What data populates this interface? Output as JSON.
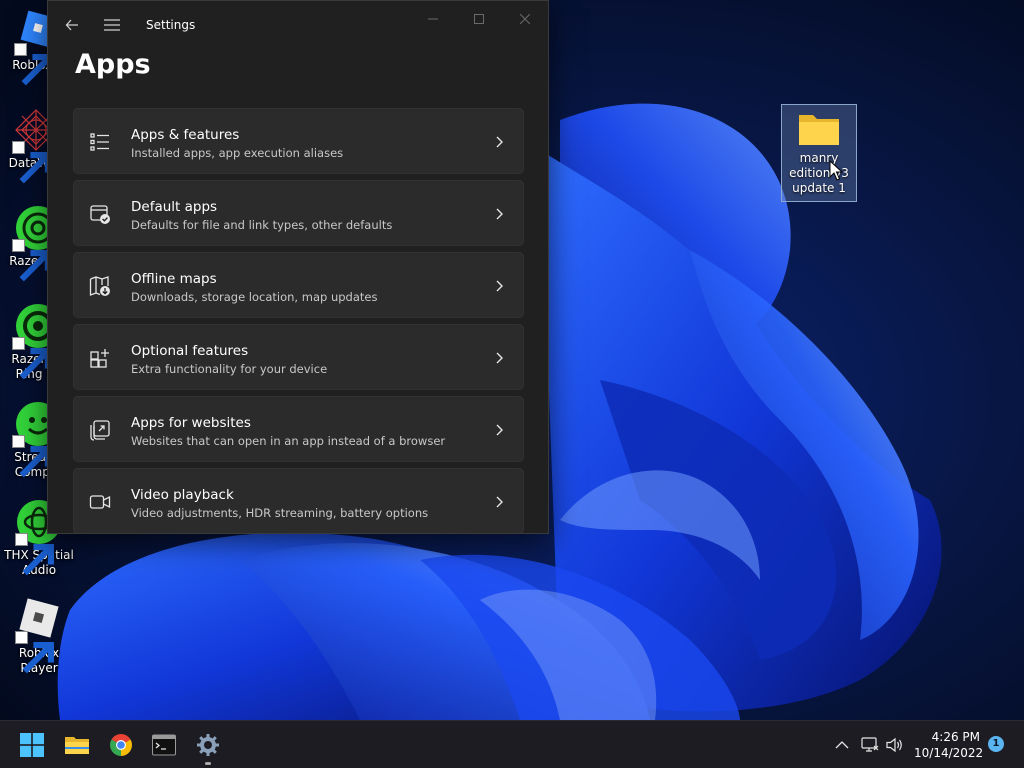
{
  "desktop": {
    "icons": [
      {
        "label": "Roblox S",
        "icon": "roblox-studio-icon"
      },
      {
        "label": "DataWag",
        "icon": "datawag-icon"
      },
      {
        "label": "Razer Co",
        "icon": "razer-cortex-icon"
      },
      {
        "label": "Razer Vi Ring Li",
        "icon": "razer-ring-light-icon"
      },
      {
        "label": "Stream Compa",
        "icon": "stream-companion-icon"
      },
      {
        "label": "THX Spatial Audio",
        "icon": "thx-spatial-audio-icon"
      },
      {
        "label": "Roblox Player",
        "icon": "roblox-player-icon"
      }
    ],
    "folder": {
      "label": "manry edition v3 update 1",
      "icon": "folder-icon"
    }
  },
  "window": {
    "title": "Settings",
    "heading": "Apps",
    "items": [
      {
        "title": "Apps & features",
        "subtitle": "Installed apps, app execution aliases",
        "icon": "apps-features-icon"
      },
      {
        "title": "Default apps",
        "subtitle": "Defaults for file and link types, other defaults",
        "icon": "default-apps-icon"
      },
      {
        "title": "Offline maps",
        "subtitle": "Downloads, storage location, map updates",
        "icon": "offline-maps-icon"
      },
      {
        "title": "Optional features",
        "subtitle": "Extra functionality for your device",
        "icon": "optional-features-icon"
      },
      {
        "title": "Apps for websites",
        "subtitle": "Websites that can open in an app instead of a browser",
        "icon": "apps-for-websites-icon"
      },
      {
        "title": "Video playback",
        "subtitle": "Video adjustments, HDR streaming, battery options",
        "icon": "video-playback-icon"
      }
    ]
  },
  "taskbar": {
    "apps": [
      "start-icon",
      "file-explorer-icon",
      "chrome-icon",
      "terminal-icon",
      "settings-icon"
    ],
    "time": "4:26 PM",
    "date": "10/14/2022",
    "notification_count": "1"
  },
  "colors": {
    "window_bg": "#202020",
    "card_bg": "#2b2b2b",
    "accent": "#0078d4",
    "badge": "#5ab4f0"
  }
}
